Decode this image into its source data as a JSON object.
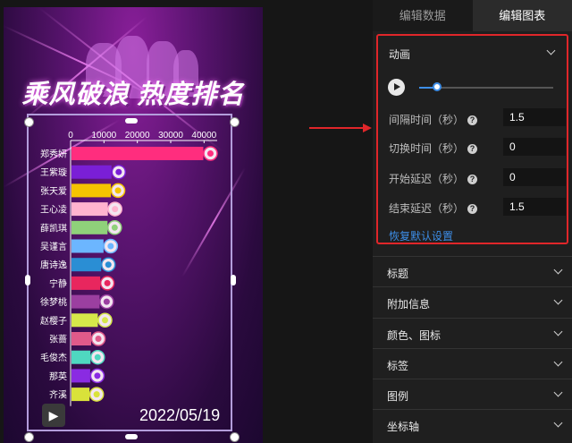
{
  "poster": {
    "title": "乘风破浪 热度排名",
    "date": "2022/05/19"
  },
  "chart_data": {
    "type": "bar",
    "orientation": "horizontal",
    "title": "",
    "x_ticks": [
      "0",
      "10000",
      "20000",
      "30000",
      "40000"
    ],
    "xlim": [
      0,
      45000
    ],
    "categories": [
      "郑秀妍",
      "王紫璇",
      "张天爱",
      "王心凌",
      "薛凯琪",
      "吴谨言",
      "唐诗逸",
      "宁静",
      "徐梦桃",
      "赵樱子",
      "张蔷",
      "毛俊杰",
      "那英",
      "齐溪"
    ],
    "values": [
      39500,
      12000,
      11800,
      10900,
      10800,
      9600,
      8900,
      8600,
      8400,
      7900,
      5900,
      5700,
      5600,
      5400
    ],
    "colors": [
      "#ff2d7e",
      "#7a1fd6",
      "#f5c400",
      "#ffb3cf",
      "#8fd17a",
      "#6cb6ff",
      "#2a8ed4",
      "#e8265e",
      "#9b3fa0",
      "#d6e84a",
      "#e05a8a",
      "#4fd8c0",
      "#8a2be2",
      "#d9e23a"
    ],
    "grid": false
  },
  "panel": {
    "tabs": [
      {
        "label": "编辑数据"
      },
      {
        "label": "编辑图表"
      }
    ],
    "animation": {
      "title": "动画",
      "progress": 0.13,
      "fields": [
        {
          "label": "间隔时间（秒）",
          "value": "1.5"
        },
        {
          "label": "切换时间（秒）",
          "value": "0"
        },
        {
          "label": "开始延迟（秒）",
          "value": "0"
        },
        {
          "label": "结束延迟（秒）",
          "value": "1.5"
        }
      ],
      "restore_label": "恢复默认设置"
    },
    "sections": [
      {
        "label": "标题"
      },
      {
        "label": "附加信息"
      },
      {
        "label": "颜色、图标"
      },
      {
        "label": "标签"
      },
      {
        "label": "图例"
      },
      {
        "label": "坐标轴"
      }
    ]
  },
  "colors": {
    "accent": "#3d8ee8",
    "highlight_border": "#e0262a"
  }
}
